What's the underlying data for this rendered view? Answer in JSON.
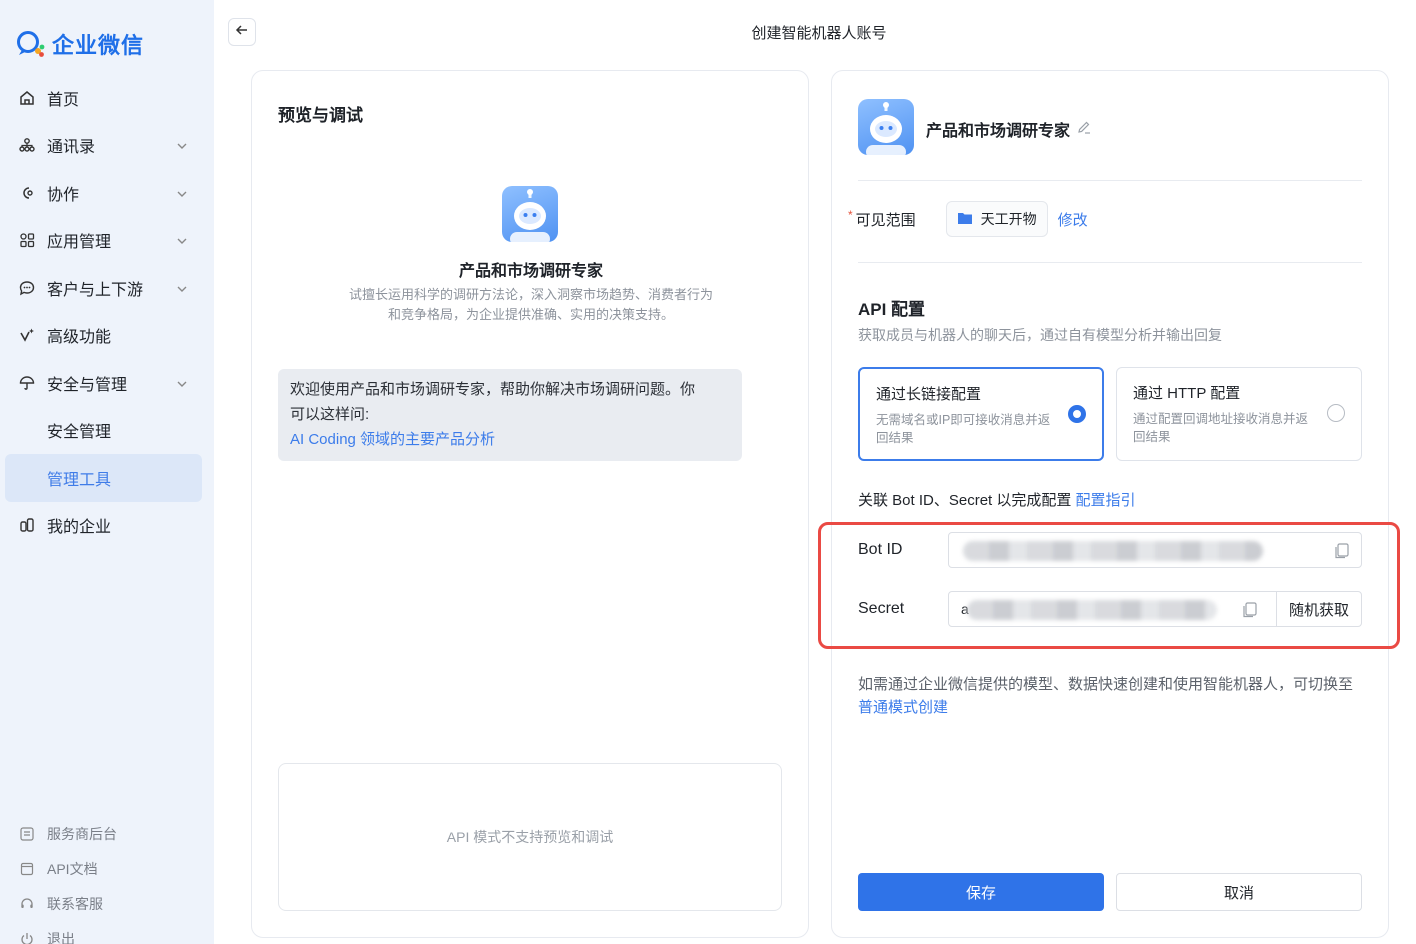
{
  "sidebar": {
    "brand": "企业微信",
    "items": [
      {
        "label": "首页"
      },
      {
        "label": "通讯录"
      },
      {
        "label": "协作"
      },
      {
        "label": "应用管理"
      },
      {
        "label": "客户与上下游"
      },
      {
        "label": "高级功能"
      },
      {
        "label": "安全与管理"
      },
      {
        "label": "安全管理"
      },
      {
        "label": "管理工具"
      },
      {
        "label": "我的企业"
      }
    ],
    "footer": [
      {
        "label": "服务商后台"
      },
      {
        "label": "API文档"
      },
      {
        "label": "联系客服"
      },
      {
        "label": "退出"
      }
    ]
  },
  "header": {
    "title": "创建智能机器人账号"
  },
  "preview": {
    "title": "预览与调试",
    "bot_name": "产品和市场调研专家",
    "bot_desc_line1": "试擅长运用科学的调研方法论，深入洞察市场趋势、消费者行为",
    "bot_desc_line2": "和竞争格局，为企业提供准确、实用的决策支持。",
    "welcome_line1": "欢迎使用产品和市场调研专家，帮助你解决市场调研问题。你",
    "welcome_line2": "可以这样问:",
    "welcome_suggestion": "AI Coding 领域的主要产品分析",
    "api_unsupported": "API 模式不支持预览和调试"
  },
  "config": {
    "bot_name": "产品和市场调研专家",
    "scope_label": "可见范围",
    "scope_value": "天工开物",
    "scope_edit": "修改",
    "api_title": "API 配置",
    "api_desc": "获取成员与机器人的聊天后，通过自有模型分析并输出回复",
    "option_long": {
      "title": "通过长链接配置",
      "desc": "无需域名或IP即可接收消息并返回结果",
      "selected": true
    },
    "option_http": {
      "title": "通过 HTTP 配置",
      "desc": "通过配置回调地址接收消息并返回结果",
      "selected": false
    },
    "link_text": "关联 Bot ID、Secret 以完成配置",
    "link_guide": "配置指引",
    "bot_id_label": "Bot ID",
    "secret_label": "Secret",
    "secret_prefix": "a",
    "random_button": "随机获取",
    "mode_note": "如需通过企业微信提供的模型、数据快速创建和使用智能机器人，可切换至",
    "mode_link": "普通模式创建",
    "save": "保存",
    "cancel": "取消"
  },
  "colors": {
    "accent": "#2f73e8",
    "link": "#3c7cea",
    "highlight": "#ea4a44",
    "sidebar_bg": "#eef3fb"
  }
}
